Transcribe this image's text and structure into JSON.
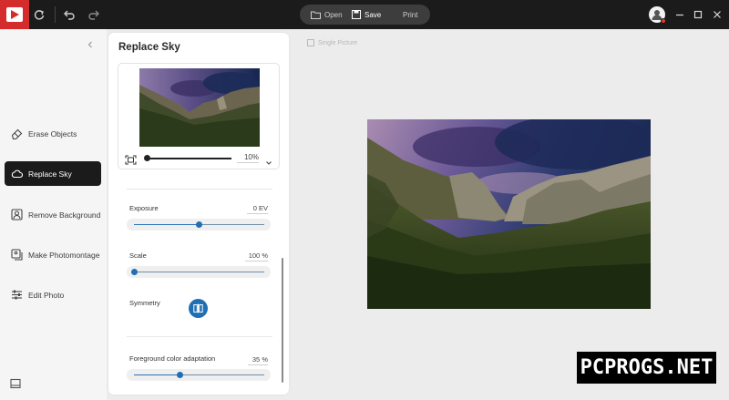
{
  "toolbar": {
    "open_label": "Open",
    "save_label": "Save",
    "print_label": "Print",
    "icons": {
      "logo": "app-logo-icon",
      "sync": "sync-icon",
      "undo": "undo-icon",
      "redo": "redo-icon",
      "open": "folder-icon",
      "save": "floppy-disk-icon",
      "user": "user-icon",
      "minimize": "minimize-icon",
      "maximize": "maximize-icon",
      "close": "close-icon"
    }
  },
  "sidebar": {
    "items": [
      {
        "label": "Erase Objects",
        "icon": "eraser-icon",
        "active": false
      },
      {
        "label": "Replace Sky",
        "icon": "cloud-icon",
        "active": true
      },
      {
        "label": "Remove Background",
        "icon": "person-cutout-icon",
        "active": false
      },
      {
        "label": "Make Photomontage",
        "icon": "photomontage-icon",
        "active": false
      },
      {
        "label": "Edit Photo",
        "icon": "sliders-icon",
        "active": false
      }
    ]
  },
  "panel": {
    "title": "Replace Sky",
    "zoom_value": "10%",
    "sliders": [
      {
        "label": "Exposure",
        "value_text": "0 EV",
        "fraction": 0.5
      },
      {
        "label": "Scale",
        "value_text": "100 %",
        "fraction": 0.0
      },
      {
        "label": "Foreground color adaptation",
        "value_text": "35 %",
        "fraction": 0.35
      }
    ],
    "symmetry_label": "Symmetry"
  },
  "canvas": {
    "label": "Single Picture"
  },
  "watermark": "PCPROGS.NET",
  "colors": {
    "topbar": "#1b1b1b",
    "logo": "#d42c2c",
    "accent": "#1f6fb5",
    "active_nav": "#1b1b1b"
  }
}
